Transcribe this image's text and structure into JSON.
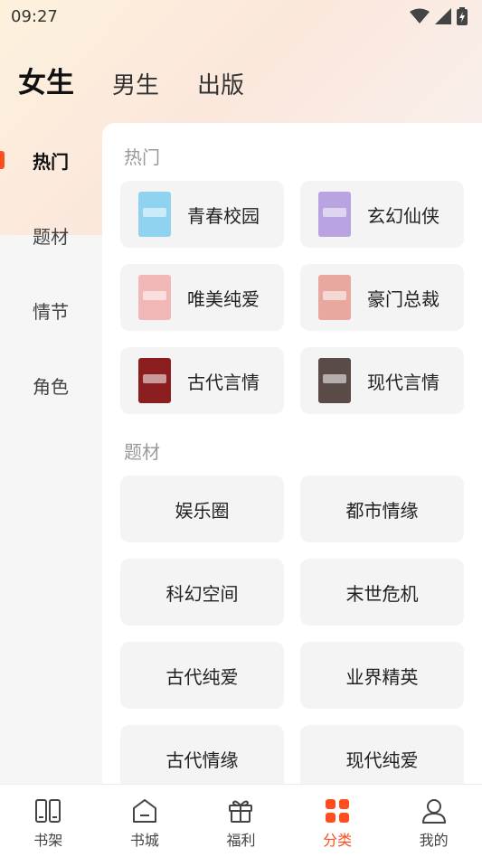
{
  "status_bar": {
    "time": "09:27"
  },
  "gender_tabs": [
    {
      "label": "女生",
      "active": true
    },
    {
      "label": "男生",
      "active": false
    },
    {
      "label": "出版",
      "active": false
    }
  ],
  "sidebar": {
    "items": [
      {
        "label": "热门",
        "active": true
      },
      {
        "label": "题材",
        "active": false
      },
      {
        "label": "情节",
        "active": false
      },
      {
        "label": "角色",
        "active": false
      }
    ]
  },
  "sections": {
    "hot": {
      "title": "热门",
      "cards": [
        {
          "label": "青春校园",
          "cover_color": "#8fd3f0"
        },
        {
          "label": "玄幻仙侠",
          "cover_color": "#b9a3e0"
        },
        {
          "label": "唯美纯爱",
          "cover_color": "#f2b8b8"
        },
        {
          "label": "豪门总裁",
          "cover_color": "#e8a8a0"
        },
        {
          "label": "古代言情",
          "cover_color": "#8b1f1f"
        },
        {
          "label": "现代言情",
          "cover_color": "#5a4a48"
        }
      ]
    },
    "theme": {
      "title": "题材",
      "cards": [
        {
          "label": "娱乐圈"
        },
        {
          "label": "都市情缘"
        },
        {
          "label": "科幻空间"
        },
        {
          "label": "末世危机"
        },
        {
          "label": "古代纯爱"
        },
        {
          "label": "业界精英"
        },
        {
          "label": "古代情缘"
        },
        {
          "label": "现代纯爱"
        }
      ]
    }
  },
  "bottom_nav": {
    "items": [
      {
        "label": "书架",
        "icon": "bookshelf-icon",
        "active": false
      },
      {
        "label": "书城",
        "icon": "bookstore-icon",
        "active": false
      },
      {
        "label": "福利",
        "icon": "gift-icon",
        "active": false
      },
      {
        "label": "分类",
        "icon": "category-icon",
        "active": true
      },
      {
        "label": "我的",
        "icon": "profile-icon",
        "active": false
      }
    ]
  },
  "colors": {
    "accent": "#ff4d1f",
    "card_bg": "#f4f4f4",
    "muted_text": "#999999"
  }
}
